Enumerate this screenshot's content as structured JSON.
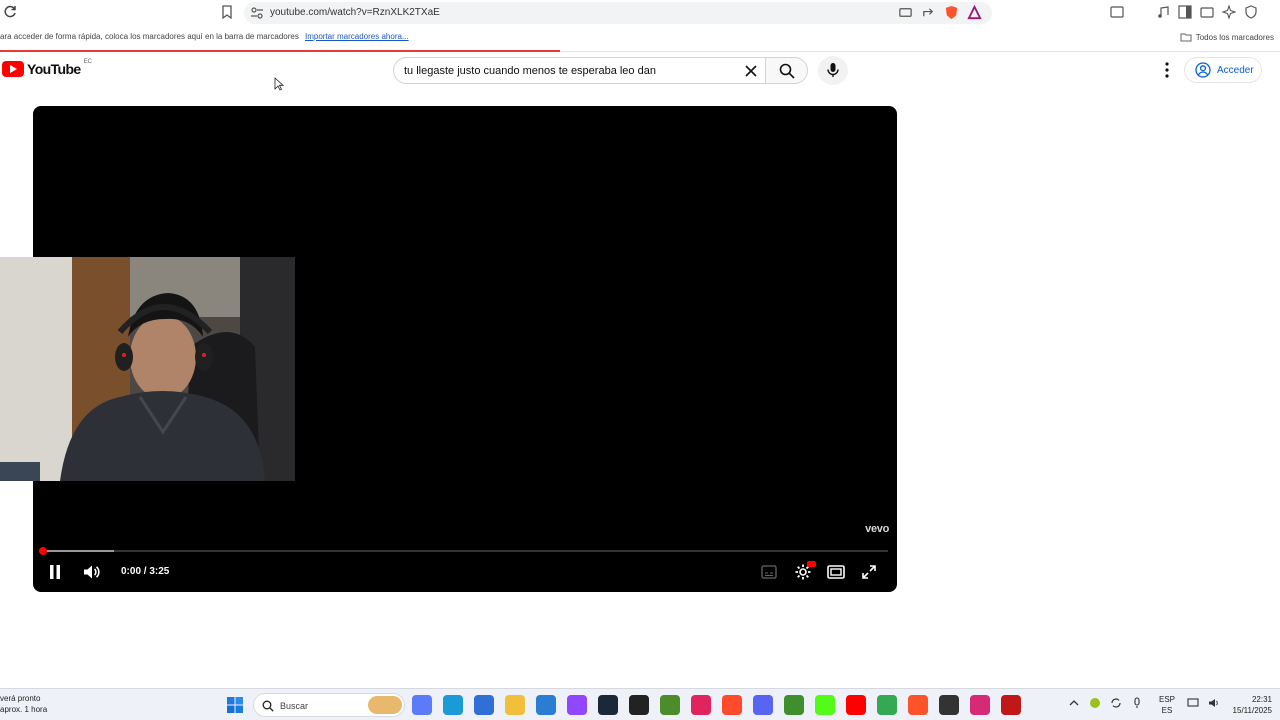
{
  "browser": {
    "url": "youtube.com/watch?v=RznXLK2TXaE",
    "bookmarks_hint": "ara acceder de forma rápida, coloca los marcadores aquí en la barra de marcadores",
    "import_link": "Importar marcadores ahora...",
    "all_bookmarks": "Todos los marcadores"
  },
  "youtube": {
    "logo_text": "YouTube",
    "country_code": "EC",
    "search_query": "tu llegaste justo cuando menos te esperaba leo dan",
    "signin_label": "Acceder"
  },
  "player": {
    "watermark": "vevo",
    "time": "0:00 / 3:25",
    "progress_fraction": 0.0,
    "buffered_fraction": 0.085,
    "state": "playing"
  },
  "taskbar": {
    "weather_line1": "verá pronto",
    "weather_line2": "aprox. 1 hora",
    "search_placeholder": "Buscar",
    "lang_line1": "ESP",
    "lang_line2": "ES",
    "time": "22:31",
    "date": "15/11/2025",
    "apps": [
      {
        "name": "widgets-icon",
        "color": "#5b7cf6"
      },
      {
        "name": "edge-icon",
        "color": "#1a9bd7"
      },
      {
        "name": "store-icon",
        "color": "#2f6fd6"
      },
      {
        "name": "file-explorer-icon",
        "color": "#f2bf3c"
      },
      {
        "name": "outlook-icon",
        "color": "#2b7cd3"
      },
      {
        "name": "twitch-icon",
        "color": "#9146ff"
      },
      {
        "name": "steam-icon",
        "color": "#1b2838"
      },
      {
        "name": "capcut-icon",
        "color": "#222222"
      },
      {
        "name": "vegas-icon",
        "color": "#4c8c2b"
      },
      {
        "name": "tiktok-icon",
        "color": "#e0245e"
      },
      {
        "name": "tf-icon",
        "color": "#ff4b2b"
      },
      {
        "name": "discord-icon",
        "color": "#5865f2"
      },
      {
        "name": "minecraft-icon",
        "color": "#3f8f2f"
      },
      {
        "name": "kick-icon",
        "color": "#53fc18"
      },
      {
        "name": "youtube-app-icon",
        "color": "#ff0000"
      },
      {
        "name": "chrome-icon",
        "color": "#34a853"
      },
      {
        "name": "brave-icon",
        "color": "#fb542b"
      },
      {
        "name": "obs-icon",
        "color": "#333333"
      },
      {
        "name": "instagram-icon",
        "color": "#d62976"
      },
      {
        "name": "mcafee-icon",
        "color": "#c01818"
      }
    ]
  }
}
